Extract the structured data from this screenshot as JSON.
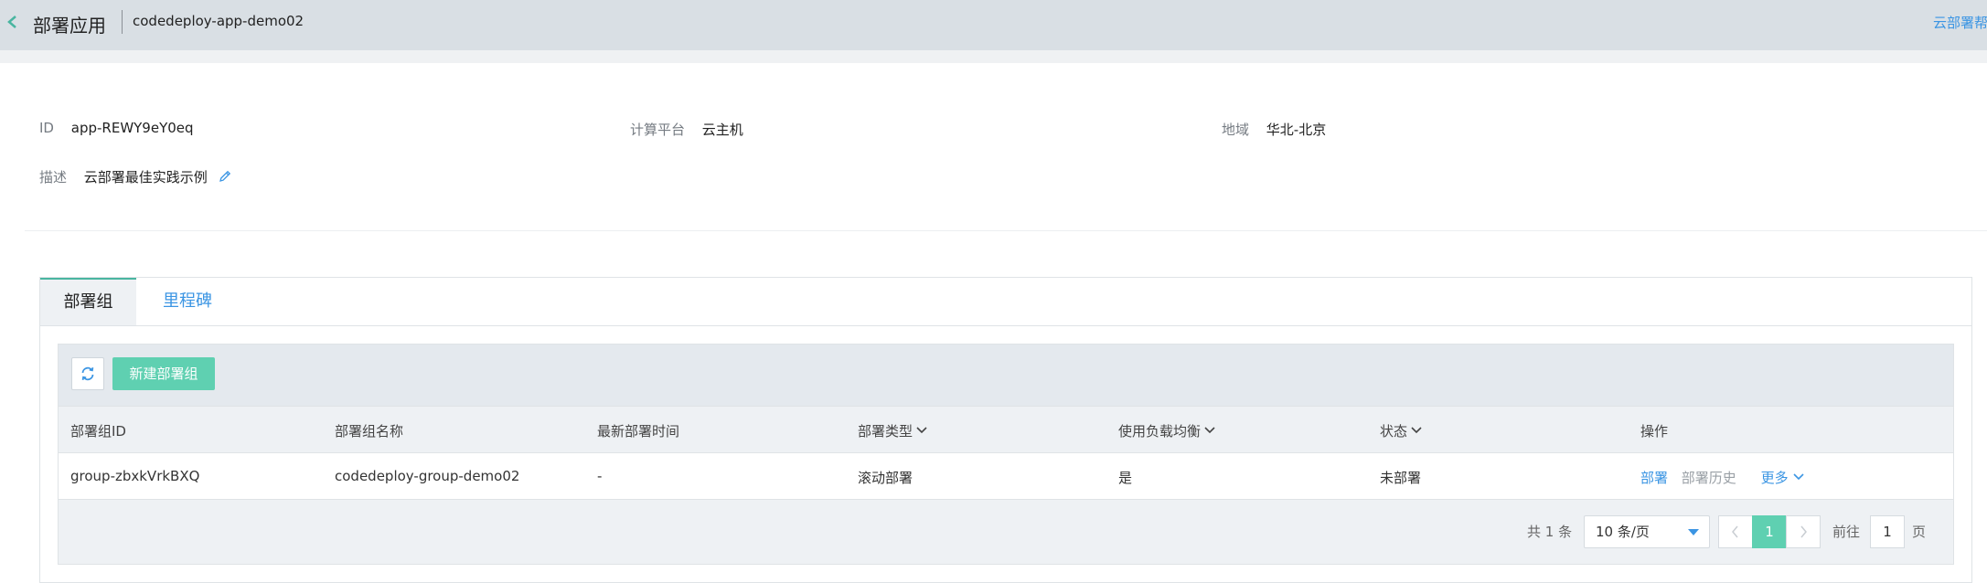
{
  "header": {
    "title": "部署应用",
    "app_name": "codedeploy-app-demo02",
    "help_link": "云部署帮助"
  },
  "info": {
    "id_label": "ID",
    "id_value": "app-REWY9eY0eq",
    "platform_label": "计算平台",
    "platform_value": "云主机",
    "region_label": "地域",
    "region_value": "华北-北京",
    "desc_label": "描述",
    "desc_value": "云部署最佳实践示例"
  },
  "tabs": [
    {
      "label": "部署组",
      "active": true
    },
    {
      "label": "里程碑",
      "active": false
    }
  ],
  "toolbar": {
    "new_group_label": "新建部署组"
  },
  "table": {
    "columns": [
      "部署组ID",
      "部署组名称",
      "最新部署时间",
      "部署类型",
      "使用负载均衡",
      "状态",
      "操作"
    ],
    "rows": [
      {
        "id": "group-zbxkVrkBXQ",
        "name": "codedeploy-group-demo02",
        "last_deploy": "-",
        "type": "滚动部署",
        "load_balancer": "是",
        "status": "未部署",
        "actions": {
          "deploy": "部署",
          "history": "部署历史",
          "more": "更多"
        }
      }
    ]
  },
  "pagination": {
    "total_text": "共 1 条",
    "page_size": "10 条/页",
    "current_page": "1",
    "goto_label": "前往",
    "goto_value": "1",
    "page_suffix": "页"
  },
  "colors": {
    "accent": "#5fd0b1",
    "link": "#3b95e3",
    "topbar": "#d9dfe4"
  }
}
